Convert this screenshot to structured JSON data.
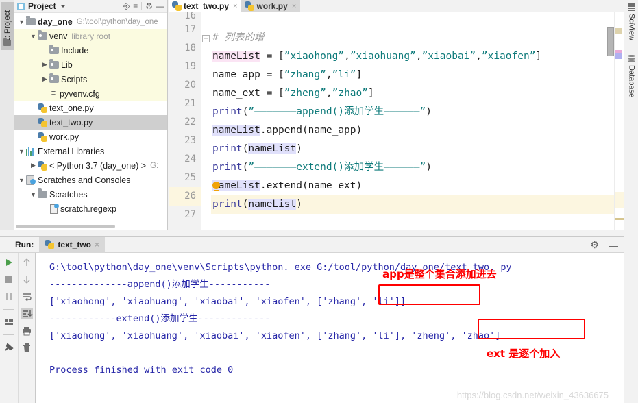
{
  "window": {
    "left_tool_tab": "1: Project",
    "right_tool_tabs": [
      "SciView",
      "Database"
    ]
  },
  "project_panel": {
    "title": "Project",
    "icons": [
      "collapse-all-icon",
      "settings-icon",
      "minimize-icon"
    ],
    "tree": [
      {
        "label": "day_one",
        "path": "G:\\tool\\python\\day_one",
        "icon": "folder-icon",
        "twisty": "expanded",
        "indent": 0,
        "bold": true,
        "state": "normal"
      },
      {
        "label": "venv",
        "note": "library root",
        "icon": "folder-dot-icon",
        "twisty": "expanded",
        "indent": 1,
        "bold": false,
        "state": "band"
      },
      {
        "label": "Include",
        "icon": "folder-dot-icon",
        "twisty": "none",
        "indent": 2,
        "bold": false,
        "state": "band"
      },
      {
        "label": "Lib",
        "icon": "folder-dot-icon",
        "twisty": "collapsed",
        "indent": 2,
        "bold": false,
        "state": "band"
      },
      {
        "label": "Scripts",
        "icon": "folder-dot-icon",
        "twisty": "collapsed",
        "indent": 2,
        "bold": false,
        "state": "band"
      },
      {
        "label": "pyvenv.cfg",
        "icon": "config-file-icon",
        "twisty": "none",
        "indent": 2,
        "bold": false,
        "state": "band"
      },
      {
        "label": "text_one.py",
        "icon": "python-file-icon",
        "twisty": "none",
        "indent": 1,
        "bold": false,
        "state": "normal"
      },
      {
        "label": "text_two.py",
        "icon": "python-file-icon",
        "twisty": "none",
        "indent": 1,
        "bold": false,
        "state": "selected"
      },
      {
        "label": "work.py",
        "icon": "python-file-icon",
        "twisty": "none",
        "indent": 1,
        "bold": false,
        "state": "normal"
      },
      {
        "label": "External Libraries",
        "icon": "libraries-icon",
        "twisty": "expanded",
        "indent": 0,
        "bold": false,
        "state": "normal"
      },
      {
        "label": "< Python 3.7 (day_one) >",
        "path": "G:",
        "icon": "python-sdk-icon",
        "twisty": "collapsed",
        "indent": 1,
        "bold": false,
        "state": "normal"
      },
      {
        "label": "Scratches and Consoles",
        "icon": "scratches-icon",
        "twisty": "expanded",
        "indent": 0,
        "bold": false,
        "state": "normal"
      },
      {
        "label": "Scratches",
        "icon": "folder-icon",
        "twisty": "expanded",
        "indent": 1,
        "bold": false,
        "state": "normal"
      },
      {
        "label": "scratch.regexp",
        "icon": "scratch-file-icon",
        "twisty": "none",
        "indent": 2,
        "bold": false,
        "state": "normal"
      }
    ]
  },
  "editor": {
    "tabs": [
      {
        "label": "text_two.py",
        "active": true,
        "close": "×"
      },
      {
        "label": "work.py",
        "active": false,
        "close": "×"
      }
    ],
    "first_partial_line_number": "16",
    "current_line": 26,
    "lines": [
      {
        "no": "17",
        "segments": [
          {
            "t": "# 列表的增",
            "c": "tok-comment"
          }
        ],
        "fold": true
      },
      {
        "no": "18",
        "segments": [
          {
            "t": "nameList",
            "c": "tok-var hl-pink"
          },
          {
            "t": " = [",
            "c": "tok-punct"
          },
          {
            "t": "”xiaohong”",
            "c": "tok-str"
          },
          {
            "t": ",",
            "c": "tok-punct"
          },
          {
            "t": "”xiaohuang”",
            "c": "tok-str"
          },
          {
            "t": ",",
            "c": "tok-punct"
          },
          {
            "t": "”xiaobai”",
            "c": "tok-str"
          },
          {
            "t": ",",
            "c": "tok-punct"
          },
          {
            "t": "”xiaofen”",
            "c": "tok-str"
          },
          {
            "t": "]",
            "c": "tok-punct"
          }
        ]
      },
      {
        "no": "19",
        "segments": [
          {
            "t": "name_app = [",
            "c": "tok-var"
          },
          {
            "t": "”zhang”",
            "c": "tok-str"
          },
          {
            "t": ",",
            "c": "tok-punct"
          },
          {
            "t": "”li”",
            "c": "tok-str"
          },
          {
            "t": "]",
            "c": "tok-punct"
          }
        ]
      },
      {
        "no": "20",
        "segments": [
          {
            "t": "name_ext = [",
            "c": "tok-var"
          },
          {
            "t": "”zheng”",
            "c": "tok-str"
          },
          {
            "t": ",",
            "c": "tok-punct"
          },
          {
            "t": "”zhao”",
            "c": "tok-str"
          },
          {
            "t": "]",
            "c": "tok-punct"
          }
        ]
      },
      {
        "no": "21",
        "segments": [
          {
            "t": "print",
            "c": "tok-fn"
          },
          {
            "t": "(",
            "c": "tok-punct"
          },
          {
            "t": "”———————append()添加学生——————”",
            "c": "tok-str"
          },
          {
            "t": ")",
            "c": "tok-punct"
          }
        ]
      },
      {
        "no": "22",
        "segments": [
          {
            "t": "nameList",
            "c": "tok-var hl-blue"
          },
          {
            "t": ".append(name_app)",
            "c": "tok-var"
          }
        ]
      },
      {
        "no": "23",
        "segments": [
          {
            "t": "print",
            "c": "tok-fn"
          },
          {
            "t": "(",
            "c": "tok-punct"
          },
          {
            "t": "nameList",
            "c": "tok-var hl-blue"
          },
          {
            "t": ")",
            "c": "tok-punct"
          }
        ]
      },
      {
        "no": "24",
        "segments": [
          {
            "t": "print",
            "c": "tok-fn"
          },
          {
            "t": "(",
            "c": "tok-punct"
          },
          {
            "t": "”———————extend()添加学生——————”",
            "c": "tok-str"
          },
          {
            "t": ")",
            "c": "tok-punct"
          }
        ]
      },
      {
        "no": "25",
        "segments": [
          {
            "t": "nameList",
            "c": "tok-var hl-blue"
          },
          {
            "t": ".extend(name_ext)",
            "c": "tok-var"
          }
        ],
        "bulb": true
      },
      {
        "no": "26",
        "segments": [
          {
            "t": "print",
            "c": "tok-fn"
          },
          {
            "t": "(",
            "c": "tok-punct"
          },
          {
            "t": "nameList",
            "c": "tok-var hl-blue"
          },
          {
            "t": ")",
            "c": "tok-punct"
          }
        ],
        "caret": true
      },
      {
        "no": "27",
        "segments": []
      }
    ]
  },
  "run_panel": {
    "label": "Run:",
    "tab_label": "text_two",
    "tab_close": "×",
    "header_icons": [
      "settings-icon",
      "minimize-icon"
    ],
    "toolbar_left": [
      "run-icon",
      "stop-icon",
      "pause-icon",
      "layout-icon",
      "pin-icon"
    ],
    "toolbar_right": [
      "up-arrow-icon",
      "down-arrow-icon",
      "soft-wrap-icon",
      "scroll-to-end-icon",
      "print-icon",
      "trash-icon"
    ],
    "console_lines": [
      "G:\\tool\\python\\day_one\\venv\\Scripts\\python. exe G:/tool/python/day_one/text_two. py",
      "--------------append()添加学生-----------",
      "['xiaohong', 'xiaohuang', 'xiaobai', 'xiaofen', ['zhang', 'li']]",
      "------------extend()添加学生-------------",
      "['xiaohong', 'xiaohuang', 'xiaobai', 'xiaofen', ['zhang', 'li'], 'zheng', 'zhao']",
      "",
      "Process finished with exit code 0"
    ],
    "annotations": [
      {
        "name": "annotation-append-note",
        "text": "app是整个集合添加进去"
      },
      {
        "name": "annotation-extend-note",
        "text": "ext 是逐个加入"
      }
    ],
    "annotation_color": "#ff0000"
  },
  "watermark": "https://blog.csdn.net/weixin_43636675",
  "colors": {
    "accent_red": "#ff0000",
    "console_text": "#2727a8",
    "string_teal": "#0f7b7b",
    "keyword_blue": "#3c3c9c",
    "current_line_bg": "#fcf6e0",
    "venv_band_bg": "#fbfbe0",
    "selection_bg": "#cfcfcf"
  }
}
